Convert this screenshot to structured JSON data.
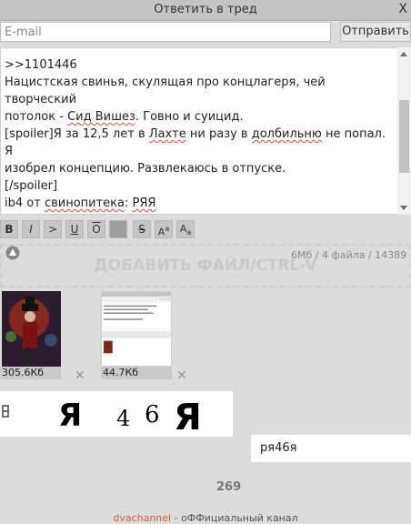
{
  "window": {
    "title": "Ответить в тред",
    "close": "X"
  },
  "email": {
    "placeholder": "E-mail",
    "value": ""
  },
  "send_button": "Отправить",
  "message": {
    "lines": [
      ">>1101446",
      "Нацистская свинья, скулящая про концлагеря, чей творческий",
      "потолок - Сид Вишез. Говно и суицид.",
      "",
      "[spoiler]Я за 12,5 лет в Лахте ни разу в долбильню не попал. Я",
      "изобрел концепцию. Развлекаюсь в отпуске.",
      "[/spoiler]",
      "",
      "ib4 от свинопитека: РЯЯ"
    ],
    "counter": "6Мб / 4 файла / 14389"
  },
  "toolbar": {
    "bold": "B",
    "italic": "I",
    "quote": ">",
    "underline": "U",
    "overline": "O",
    "spoiler": "",
    "strike": "S",
    "sup": "Aa",
    "sub": "Aa"
  },
  "dropzone": "ДОБАВИТЬ ФАЙЛ/CTRL-V",
  "files": [
    {
      "size": "305.6Кб",
      "remove": "✕"
    },
    {
      "size": "44.7Кб",
      "remove": "✕"
    }
  ],
  "captcha": {
    "glyphs": [
      "Я",
      "4",
      "6",
      "Я"
    ],
    "answer": "ря46я"
  },
  "char_count": "269",
  "footer": {
    "link": "dvachannel",
    "text": " - оФФициальный канал"
  }
}
